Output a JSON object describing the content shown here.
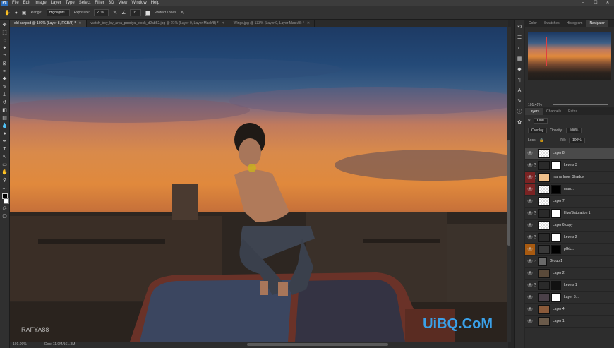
{
  "menubar": {
    "logo": "Ps",
    "items": [
      "File",
      "Edit",
      "Image",
      "Layer",
      "Type",
      "Select",
      "Filter",
      "3D",
      "View",
      "Window",
      "Help"
    ],
    "window_controls": [
      "–",
      "☐",
      "✕"
    ]
  },
  "options": {
    "range_label": "Range:",
    "range_value": "Highlights",
    "exposure_label": "Exposure:",
    "exposure_value": "27%",
    "angle_value": "0°",
    "protect_tones_label": "Protect Tones"
  },
  "tabs": [
    {
      "label": "old car.psd @ 101% (Layer 8, RGB/8) *",
      "active": true
    },
    {
      "label": "watch_boy_by_arya_pooriya_stock_d2ab52.jpg @ 21% (Layer 0, Layer Mask/8) *",
      "active": false
    },
    {
      "label": "Wings.jpg @ 133% (Layer 0, Layer Mask/8) *",
      "active": false
    }
  ],
  "canvas": {
    "watermark": "RAFYA88",
    "site": "UiBQ.CoM"
  },
  "status": {
    "zoom": "101.09%",
    "doc": "Doc: 11.9M/161.3M"
  },
  "navigator": {
    "tabs": [
      "Color",
      "Swatches",
      "Histogram",
      "Navigator"
    ],
    "active_tab": "Navigator",
    "zoom": "101.41%"
  },
  "layers_panel": {
    "tabs": [
      "Layers",
      "Channels",
      "Paths"
    ],
    "active_tab": "Layers",
    "filter_kind": "Kind",
    "blend_mode": "Overlay",
    "opacity_label": "Opacity:",
    "opacity_value": "100%",
    "lock_label": "Lock:",
    "fill_label": "Fill:",
    "fill_value": "100%",
    "layers": [
      {
        "name": "Layer 8",
        "selected": true
      },
      {
        "name": "Levels 3"
      },
      {
        "name": "man's Inner Shadow"
      },
      {
        "name": "man..."
      },
      {
        "name": "Layer 7"
      },
      {
        "name": "Hue/Saturation 1"
      },
      {
        "name": "Layer 6 copy"
      },
      {
        "name": "Levels 2"
      },
      {
        "name": "plikk..."
      },
      {
        "name": "Group 1"
      },
      {
        "name": "Layer 2"
      },
      {
        "name": "Levels 1"
      },
      {
        "name": "Layer 3..."
      },
      {
        "name": "Layer 4"
      },
      {
        "name": "Layer 1"
      }
    ]
  }
}
